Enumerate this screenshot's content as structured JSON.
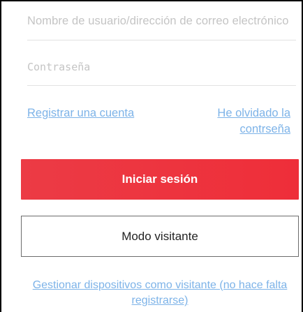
{
  "form": {
    "username_placeholder": "Nombre de usuario/dirección de correo electrónico",
    "username_value": "",
    "password_placeholder": "Contraseña",
    "password_value": ""
  },
  "links": {
    "register": "Registrar una cuenta",
    "forgot_line1": "He olvidado la",
    "forgot_line2": "contrseña",
    "guest_manage": "Gestionar dispositivos como visitante (no hace falta registrarse)"
  },
  "buttons": {
    "login": "Iniciar sesión",
    "visitor_mode": "Modo visitante"
  },
  "colors": {
    "accent_red": "#ee3440",
    "link_blue": "#7db3e8"
  }
}
